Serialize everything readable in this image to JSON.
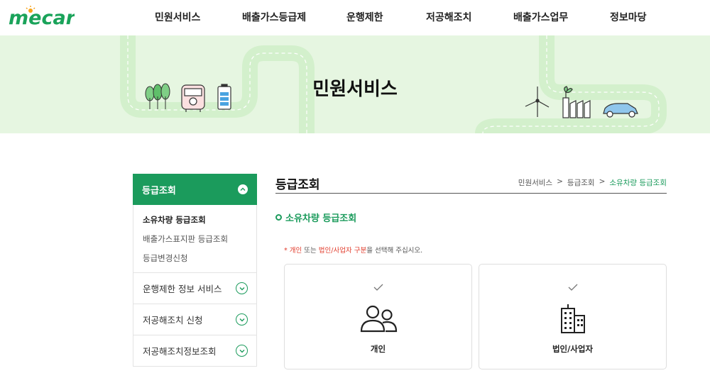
{
  "header": {
    "logo_text": "mecar",
    "nav": [
      "민원서비스",
      "배출가스등급제",
      "운행제한",
      "저공해조치",
      "배출가스업무",
      "정보마당"
    ]
  },
  "banner": {
    "title": "민원서비스"
  },
  "sidebar": {
    "active_group": "등급조회",
    "sub_items": [
      "소유차량 등급조회",
      "배출가스표지판 등급조회",
      "등급변경신청"
    ],
    "menus": [
      "운행제한 정보 서비스",
      "저공해조치 신청",
      "저공해조치정보조회"
    ]
  },
  "content": {
    "title": "등급조회",
    "breadcrumb": [
      "민원서비스",
      "등급조회",
      "소유차량 등급조회"
    ],
    "breadcrumb_sep": ">",
    "section_title": "소유차량 등급조회",
    "notice": {
      "star": "*",
      "opt1": "개인",
      "mid": " 또는 ",
      "opt2": "법인/사업자 구분",
      "tail": "을 선택해 주십시오."
    },
    "cards": [
      {
        "label": "개인",
        "icon": "people-icon"
      },
      {
        "label": "법인/사업자",
        "icon": "building-icon"
      }
    ]
  },
  "colors": {
    "accent": "#1b9b5c",
    "banner_bg": "#e6f6e1",
    "notice_red": "#e13a2a"
  }
}
